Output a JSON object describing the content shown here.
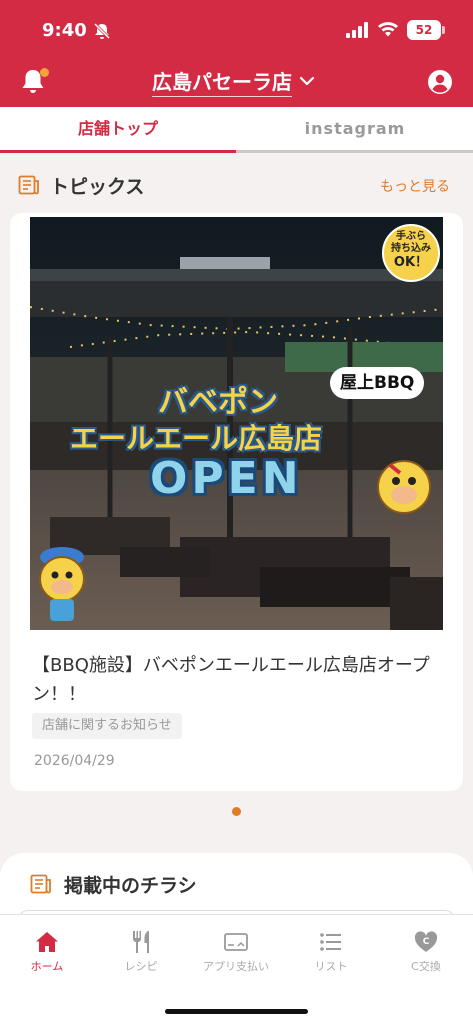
{
  "status_bar": {
    "time": "9:40",
    "battery": "52"
  },
  "header": {
    "store_name": "広島パセーラ店"
  },
  "tabs": [
    {
      "label": "店舗トップ",
      "active": true
    },
    {
      "label": "instagram",
      "active": false
    }
  ],
  "topics": {
    "title": "トピックス",
    "more_link": "もっと見る",
    "card": {
      "image": {
        "badge_lines": [
          "手ぶら",
          "持ち込み",
          "OK！"
        ],
        "title_line1": "バベポン",
        "title_line2": "エールエール広島店",
        "open_text": "OPEN",
        "rooftop_label": "屋上BBQ"
      },
      "title": "【BBQ施設】バベポンエールエール広島店オープン！！",
      "tag": "店舗に関するお知らせ",
      "date": "2026/04/29"
    }
  },
  "flyers": {
    "title": "掲載中のチラシ"
  },
  "bottom_nav": [
    {
      "label": "ホーム",
      "icon": "home-icon",
      "active": true
    },
    {
      "label": "レシピ",
      "icon": "fork-knife-icon",
      "active": false
    },
    {
      "label": "アプリ支払い",
      "icon": "card-payment-icon",
      "active": false
    },
    {
      "label": "リスト",
      "icon": "list-icon",
      "active": false
    },
    {
      "label": "C交換",
      "icon": "coin-exchange-icon",
      "active": false
    }
  ],
  "colors": {
    "brand": "#d42b45",
    "accent": "#e07b2a"
  }
}
